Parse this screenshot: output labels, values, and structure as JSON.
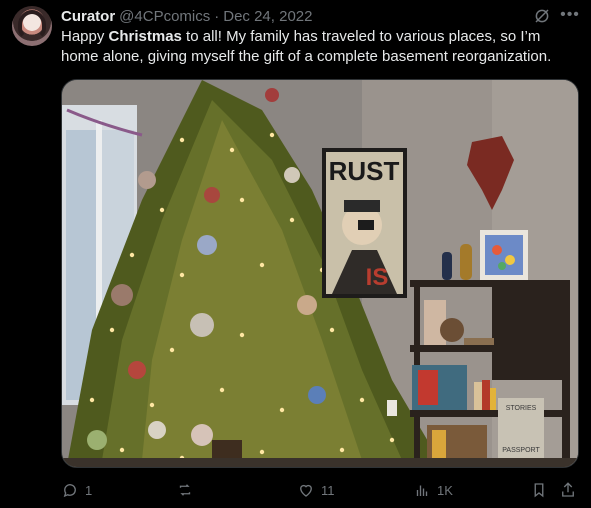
{
  "author": {
    "name": "Curator",
    "handle": "@4CPcomics",
    "separator": "·",
    "date": "Dec 24, 2022"
  },
  "tweet": {
    "text_pre": "Happy ",
    "text_bold": "Christmas",
    "text_post": " to all! My family has traveled to various places, so I’m home alone, giving myself the gift of a complete basement reorganization."
  },
  "media": {
    "poster_text_top": "RUST",
    "poster_text_bottom": "IS",
    "book_title": "STORIES",
    "book_subtitle": "PASSPORT"
  },
  "actions": {
    "replies": "1",
    "reposts": "",
    "likes": "11",
    "views": "1K"
  },
  "icons": [
    "avatar",
    "grok-icon",
    "more-icon",
    "reply-icon",
    "repost-icon",
    "like-icon",
    "views-icon",
    "bookmark-icon",
    "share-icon"
  ],
  "colors": {
    "background": "#000000",
    "text": "#e7e9ea",
    "muted": "#71767b",
    "border": "#2f3336"
  }
}
